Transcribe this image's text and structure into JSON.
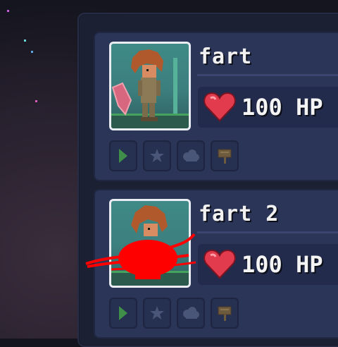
{
  "players": [
    {
      "name": "fart",
      "hp": "100 HP"
    },
    {
      "name": "fart 2",
      "hp": "100 HP"
    }
  ],
  "icons": [
    "play-icon",
    "favorite-star-icon",
    "cloud-sync-icon",
    "rename-sign-icon",
    "heart-icon"
  ],
  "colors": {
    "panel": "#1c2033",
    "card": "#2a3558",
    "hp_box": "#222b4b",
    "heart": "#e23b4d",
    "text": "#f1f1f1"
  }
}
